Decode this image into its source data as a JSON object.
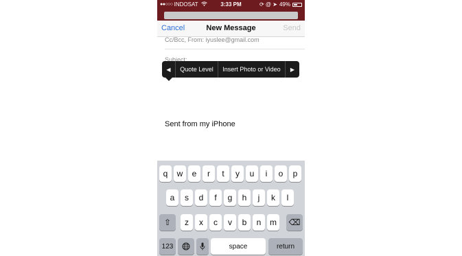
{
  "status_bar": {
    "signal": "●●○○○",
    "carrier": "INDOSAT",
    "wifi_icon": "wifi-icon",
    "time": "3:33 PM",
    "status_icons": "⟳ @ ➤",
    "battery_pct": "49%",
    "battery_level": 0.49
  },
  "nav": {
    "cancel": "Cancel",
    "title": "New Message",
    "send": "Send"
  },
  "compose": {
    "cc_from": "Cc/Bcc, From: iyuslee@gmail.com",
    "subject": "Subject:",
    "signature": "Sent from my iPhone"
  },
  "popup": {
    "left_arrow": "◀",
    "items": [
      "Quote Level",
      "Insert Photo or Video"
    ],
    "right_arrow": "▶"
  },
  "keyboard": {
    "row1": [
      "q",
      "w",
      "e",
      "r",
      "t",
      "y",
      "u",
      "i",
      "o",
      "p"
    ],
    "row2": [
      "a",
      "s",
      "d",
      "f",
      "g",
      "h",
      "j",
      "k",
      "l"
    ],
    "row3": [
      "z",
      "x",
      "c",
      "v",
      "b",
      "n",
      "m"
    ],
    "shift": "⇧",
    "delete": "⌫",
    "numbers": "123",
    "globe": "🌐",
    "mic": "🎤",
    "space": "space",
    "return": "return"
  },
  "colors": {
    "status_bg": "#6e1b20",
    "accent_blue": "#2b6fd6",
    "keyboard_bg": "#d1d4d9"
  }
}
